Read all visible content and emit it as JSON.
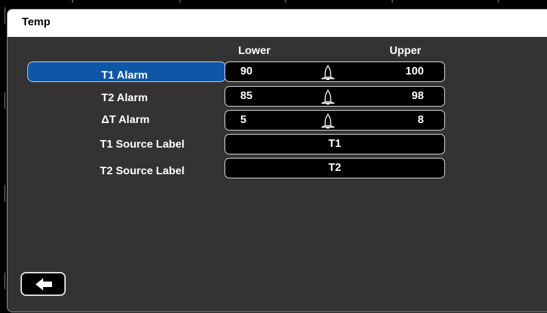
{
  "screen": {
    "title": "Temp",
    "columns": {
      "lower": "Lower",
      "upper": "Upper"
    },
    "rows": [
      {
        "label": "T1 Alarm",
        "lower": "90",
        "upper": "100",
        "selected": true,
        "icon": "alarm-bell-icon"
      },
      {
        "label": "T2 Alarm",
        "lower": "85",
        "upper": "98",
        "selected": false,
        "icon": "alarm-bell-icon"
      },
      {
        "label": "ΔT Alarm",
        "lower": "5",
        "upper": "8",
        "selected": false,
        "icon": "alarm-bell-icon"
      }
    ],
    "source_labels": [
      {
        "label": "T1 Source Label",
        "value": "T1"
      },
      {
        "label": "T2 Source Label",
        "value": "T2"
      }
    ],
    "back_icon": "back-arrow-icon"
  },
  "colors": {
    "background": "#333333",
    "selected": "#0e57a6",
    "field": "#000000",
    "title_bar": "#ffffff"
  }
}
